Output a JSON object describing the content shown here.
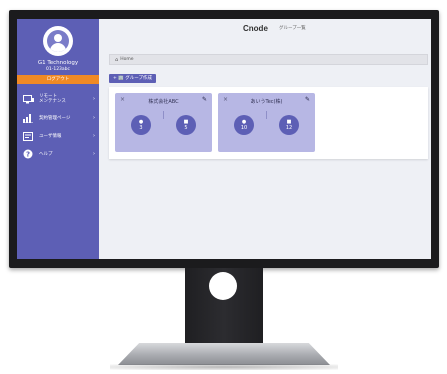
{
  "brand": "Cnode",
  "page_heading": "グループ一覧",
  "sidebar": {
    "company_name": "G1 Technology",
    "company_id": "01-123abc",
    "logout_label": "ログアウト",
    "items": [
      {
        "icon": "monitor-wrench-icon",
        "label": "リモート\nメンテナンス"
      },
      {
        "icon": "bar-chart-icon",
        "label": "契約管理ページ"
      },
      {
        "icon": "id-card-icon",
        "label": "ユーザ情報"
      },
      {
        "icon": "help-circle-icon",
        "label": "ヘルプ"
      }
    ]
  },
  "breadcrumb": {
    "home_label": "Home"
  },
  "create_group_label": "+ 🏢 グループ作成",
  "groups": [
    {
      "name": "株式会社ABC",
      "users": "3",
      "devices": "5"
    },
    {
      "name": "あいうTec(株)",
      "users": "10",
      "devices": "12"
    }
  ]
}
